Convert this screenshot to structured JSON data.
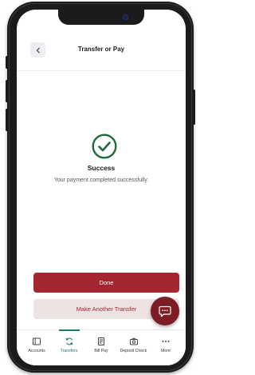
{
  "header": {
    "title": "Transfer or Pay",
    "back_icon": "chevron-left-icon"
  },
  "success": {
    "title": "Success",
    "message": "Your payment completed successfully.",
    "icon": "checkmark-circle-icon",
    "color": "#1f6b3d"
  },
  "actions": {
    "done_label": "Done",
    "another_label": "Make Another Transfer"
  },
  "chat": {
    "icon": "chat-bubble-icon"
  },
  "tabs": [
    {
      "label": "Accounts",
      "icon": "accounts-icon"
    },
    {
      "label": "Transfers",
      "icon": "transfers-icon",
      "active": true
    },
    {
      "label": "Bill Pay",
      "icon": "bill-pay-icon"
    },
    {
      "label": "Deposit Check",
      "icon": "camera-icon"
    },
    {
      "label": "More",
      "icon": "more-icon"
    }
  ],
  "colors": {
    "brand": "#a32631",
    "brand_light": "#eee2e3",
    "active_tab": "#1f7a6e"
  }
}
